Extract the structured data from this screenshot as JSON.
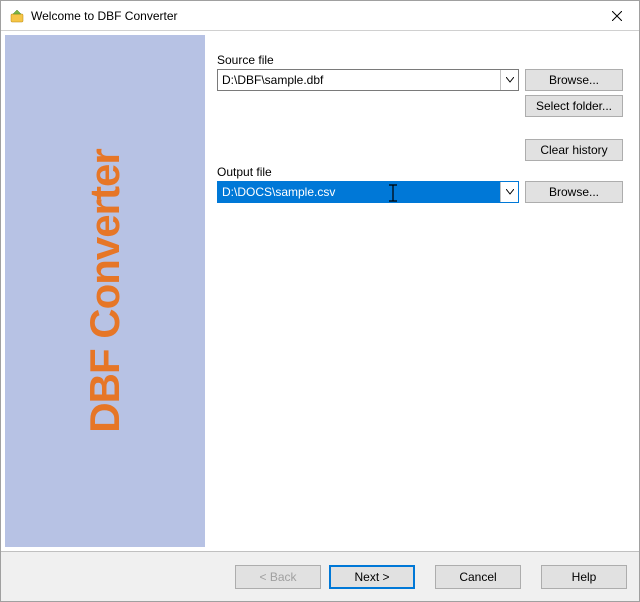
{
  "titlebar": {
    "title": "Welcome to DBF Converter"
  },
  "sidebar": {
    "brand": "DBF Converter"
  },
  "source": {
    "label": "Source file",
    "value": "D:\\DBF\\sample.dbf",
    "browse": "Browse...",
    "select_folder": "Select folder...",
    "clear_history": "Clear history"
  },
  "output": {
    "label": "Output file",
    "value": "D:\\DOCS\\sample.csv",
    "browse": "Browse..."
  },
  "footer": {
    "back": "< Back",
    "next": "Next >",
    "cancel": "Cancel",
    "help": "Help"
  }
}
